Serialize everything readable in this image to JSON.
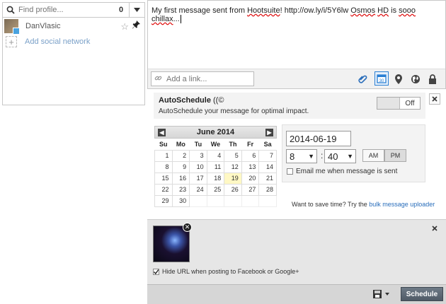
{
  "profiles": {
    "search_placeholder": "Find profile...",
    "selected_count": "0",
    "items": [
      {
        "name": "DanVlasic",
        "network": "twitter"
      }
    ],
    "add_network_label": "Add social network"
  },
  "composer": {
    "message_prefix": "My first message sent from ",
    "message_word1": "Hootsuite",
    "message_mid1": "! ",
    "message_link": "http://ow.ly/i/5Y6lw",
    "message_mid2": " ",
    "message_word2": "Osmos",
    "message_mid3": " ",
    "message_word3": "HD",
    "message_mid4": " is ",
    "message_word4": "sooo",
    "message_mid5": " ",
    "message_word5": "chillax",
    "message_suffix": "...",
    "link_placeholder": "Add a link...",
    "calendar_day_badge": "30"
  },
  "autoschedule": {
    "title": "AutoSchedule",
    "subtitle": "AutoSchedule your message for optimal impact.",
    "toggle_label": "Off"
  },
  "calendar": {
    "month_title": "June 2014",
    "weekdays": [
      "Su",
      "Mo",
      "Tu",
      "We",
      "Th",
      "Fr",
      "Sa"
    ],
    "weeks": [
      [
        "1",
        "2",
        "3",
        "4",
        "5",
        "6",
        "7"
      ],
      [
        "8",
        "9",
        "10",
        "11",
        "12",
        "13",
        "14"
      ],
      [
        "15",
        "16",
        "17",
        "18",
        "19",
        "20",
        "21"
      ],
      [
        "22",
        "23",
        "24",
        "25",
        "26",
        "27",
        "28"
      ],
      [
        "29",
        "30",
        "",
        "",
        "",
        "",
        ""
      ]
    ],
    "highlighted_day": "19"
  },
  "datetime": {
    "date_value": "2014-06-19",
    "hour_value": "8",
    "minute_value": "40",
    "am_label": "AM",
    "pm_label": "PM",
    "selected_period": "PM",
    "email_label": "Email me when message is sent"
  },
  "bulk": {
    "prefix": "Want to save time? Try the ",
    "link_label": "bulk message uploader"
  },
  "attachment": {
    "hide_url_label": "Hide URL when posting to Facebook or Google+",
    "hide_url_checked": true
  },
  "footer": {
    "schedule_label": "Schedule"
  }
}
